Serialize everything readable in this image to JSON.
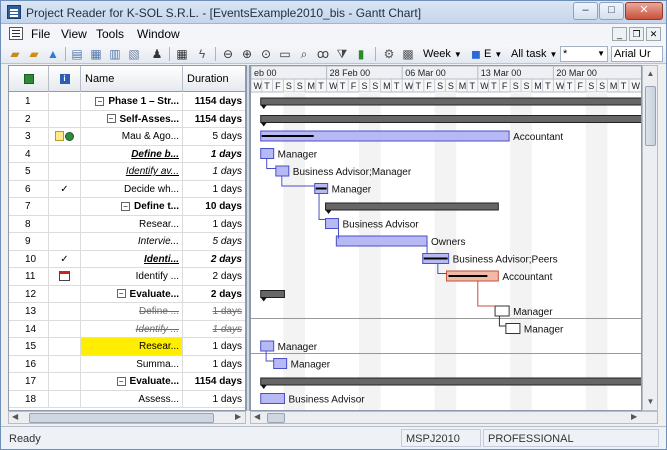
{
  "window": {
    "title": "Project Reader for K-SOL S.R.L. - [EventsExample2010_bis - Gantt Chart]"
  },
  "menu": [
    "File",
    "View",
    "Tools",
    "Window"
  ],
  "toolbar": {
    "view_label": "Week",
    "filter_label": "All task",
    "combo_value": "*",
    "font_value": "Arial Ur",
    "e_label": "E"
  },
  "grid": {
    "headers": {
      "name": "Name",
      "duration": "Duration"
    },
    "rows": [
      {
        "id": "1",
        "indicator": "",
        "name": "Phase 1 – Str...",
        "duration": "1154 days",
        "bold": true,
        "collapse": true,
        "level": 0
      },
      {
        "id": "2",
        "indicator": "",
        "name": "Self-Asses...",
        "duration": "1154 days",
        "bold": true,
        "collapse": true,
        "level": 1
      },
      {
        "id": "3",
        "indicator": "note-icon",
        "name": "Mau & Ago...",
        "duration": "5 days",
        "level": 2
      },
      {
        "id": "4",
        "indicator": "",
        "name": "Define b...",
        "duration": "1 days",
        "bold": true,
        "italic": true,
        "underline": true,
        "level": 2
      },
      {
        "id": "5",
        "indicator": "",
        "name": "Identify av...",
        "duration": "1 days",
        "italic": true,
        "underline": true,
        "level": 2
      },
      {
        "id": "6",
        "indicator": "✓",
        "name": "Decide wh...",
        "duration": "1 days",
        "level": 2
      },
      {
        "id": "7",
        "indicator": "",
        "name": "Define t...",
        "duration": "10 days",
        "bold": true,
        "collapse": true,
        "level": 1
      },
      {
        "id": "8",
        "indicator": "",
        "name": "Resear...",
        "duration": "1 days",
        "level": 2
      },
      {
        "id": "9",
        "indicator": "",
        "name": "Intervie...",
        "duration": "5 days",
        "italic": true,
        "level": 2
      },
      {
        "id": "10",
        "indicator": "✓",
        "name": "Identi...",
        "duration": "2 days",
        "bold": true,
        "italic": true,
        "underline": true,
        "level": 2
      },
      {
        "id": "11",
        "indicator": "calendar-icon",
        "name": "Identify ...",
        "duration": "2 days",
        "level": 2
      },
      {
        "id": "12",
        "indicator": "",
        "name": "Evaluate...",
        "duration": "2 days",
        "bold": true,
        "collapse": true,
        "level": 1
      },
      {
        "id": "13",
        "indicator": "",
        "name": "Define ...",
        "duration": "1 days",
        "strike": true,
        "level": 2
      },
      {
        "id": "14",
        "indicator": "",
        "name": "Identify ...",
        "duration": "1 days",
        "strike": true,
        "italic": true,
        "level": 2
      },
      {
        "id": "15",
        "indicator": "",
        "name": "Resear...",
        "duration": "1 days",
        "highlight": true,
        "level": 2
      },
      {
        "id": "16",
        "indicator": "",
        "name": "Summa...",
        "duration": "1 days",
        "level": 2
      },
      {
        "id": "17",
        "indicator": "",
        "name": "Evaluate...",
        "duration": "1154 days",
        "bold": true,
        "collapse": true,
        "level": 1
      },
      {
        "id": "18",
        "indicator": "",
        "name": "Assess...",
        "duration": "1 days",
        "level": 2
      }
    ]
  },
  "timeline": {
    "weeks": [
      "eb 00",
      "28 Feb 00",
      "06 Mar 00",
      "13 Mar 00",
      "20 Mar 00"
    ],
    "days": [
      "W",
      "T",
      "F",
      "S",
      "S",
      "M",
      "T",
      "W",
      "T",
      "F",
      "S",
      "S",
      "M",
      "T",
      "W",
      "T",
      "F",
      "S",
      "S",
      "M",
      "T",
      "W",
      "T",
      "F",
      "S",
      "S",
      "M",
      "T",
      "W",
      "T",
      "F",
      "S",
      "S",
      "M",
      "T",
      "W"
    ]
  },
  "gantt": {
    "labels": {
      "3": "Accountant",
      "4": "Manager",
      "5": "Business Advisor;Manager",
      "6": "Manager",
      "8": "Business Advisor",
      "9": "Owners",
      "10": "Business Advisor;Peers",
      "11": "Accountant",
      "13": "Manager",
      "14": "Manager",
      "15": "Manager",
      "16": "Manager",
      "18": "Business Advisor"
    }
  },
  "status": {
    "ready": "Ready",
    "format": "MSPJ2010",
    "edition": "PROFESSIONAL"
  }
}
